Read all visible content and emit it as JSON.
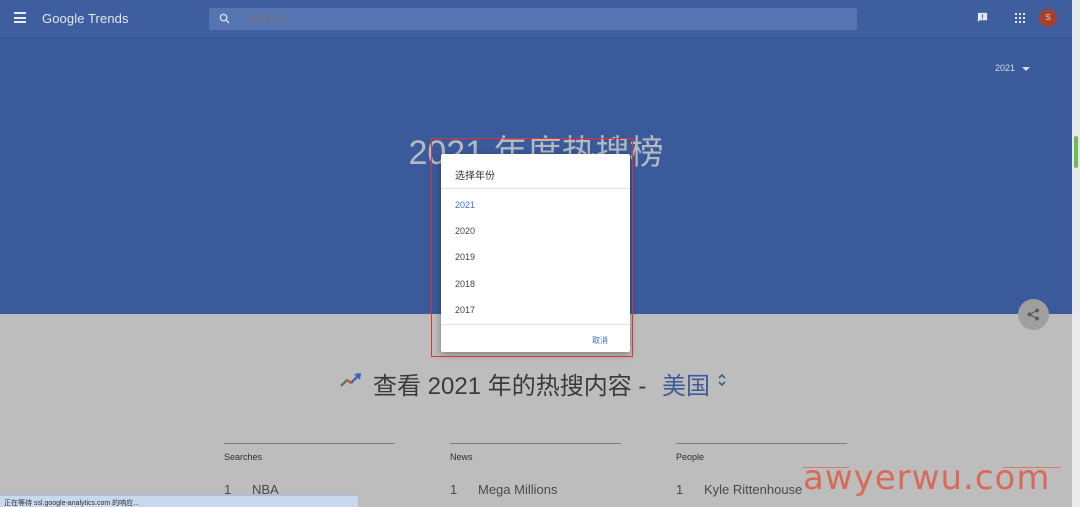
{
  "header": {
    "brand": "Google Trends",
    "search_placeholder": "探索主题",
    "avatar_letter": "S"
  },
  "hero": {
    "year_selected": "2021",
    "title": "2021 年度热搜榜"
  },
  "explore": {
    "text": "查看 2021 年的热搜内容 -",
    "country": "美国"
  },
  "columns": [
    {
      "header": "Searches",
      "items": [
        {
          "rank": "1",
          "label": "NBA"
        }
      ]
    },
    {
      "header": "News",
      "items": [
        {
          "rank": "1",
          "label": "Mega Millions"
        }
      ]
    },
    {
      "header": "People",
      "items": [
        {
          "rank": "1",
          "label": "Kyle Rittenhouse"
        }
      ]
    }
  ],
  "dialog": {
    "title": "选择年份",
    "years": [
      "2021",
      "2020",
      "2019",
      "2018",
      "2017"
    ],
    "selected_year": "2021",
    "cancel_label": "取消"
  },
  "status_bar": "正在等待 ssl.google-analytics.com 的响应...",
  "watermark": "awyerwu.com",
  "colors": {
    "header_bg": "#3e5ea0",
    "hero_bg": "#3a5a9b",
    "accent_blue": "#3f6bcc",
    "highlight_red": "#e0352b"
  }
}
